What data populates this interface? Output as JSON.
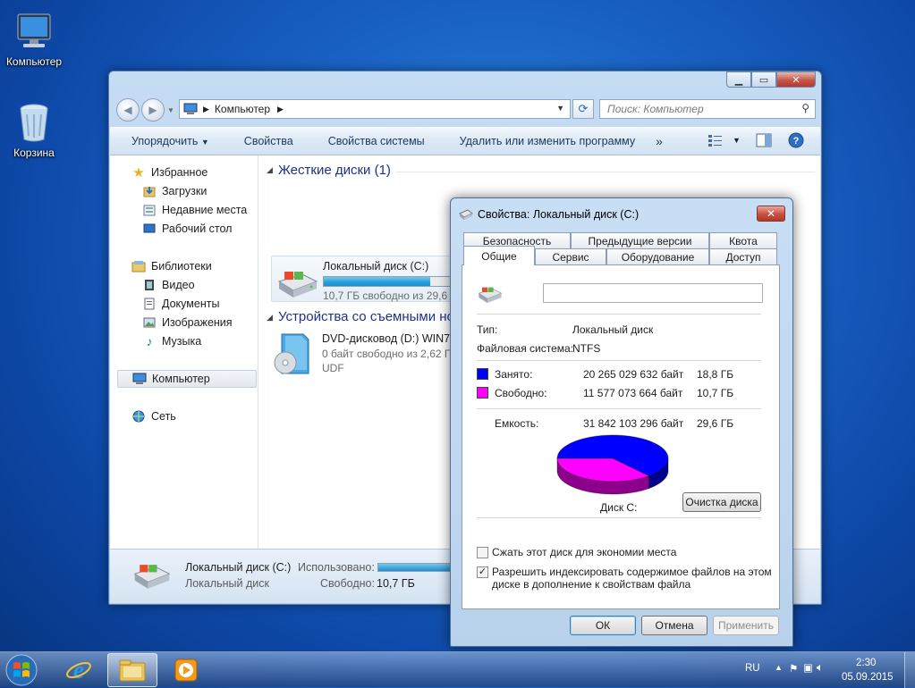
{
  "desktop": {
    "icons": [
      {
        "label": "Компьютер"
      },
      {
        "label": "Корзина"
      }
    ]
  },
  "explorer": {
    "address": "Компьютер",
    "search_placeholder": "Поиск: Компьютер",
    "commands": [
      "Упорядочить",
      "Свойства",
      "Свойства системы",
      "Удалить или изменить программу"
    ],
    "more_symbol": "»",
    "nav": {
      "favorites": "Избранное",
      "downloads": "Загрузки",
      "recent": "Недавние места",
      "desktop": "Рабочий стол",
      "libraries": "Библиотеки",
      "video": "Видео",
      "documents": "Документы",
      "images": "Изображения",
      "music": "Музыка",
      "computer": "Компьютер",
      "network": "Сеть"
    },
    "groups": {
      "hard_drives": "Жесткие диски (1)",
      "removable": "Устройства со съемными но"
    },
    "drive_c": {
      "name": "Локальный диск (C:)",
      "free_text": "10,7 ГБ свободно из 29,6 Г",
      "used_fraction": 0.64
    },
    "dvd": {
      "name": "DVD-дисковод (D:) WIN7U",
      "free_text": "0 байт свободно из 2,62 ГБ",
      "fs": "UDF"
    },
    "details": {
      "name": "Локальный диск (C:)",
      "type": "Локальный диск",
      "used_label": "Использовано:",
      "free_label": "Свободно:",
      "free_value": "10,7 ГБ"
    }
  },
  "dialog": {
    "title": "Свойства: Локальный диск (C:)",
    "close_symbol": "✕",
    "tabs_back": [
      "Безопасность",
      "Предыдущие версии",
      "Квота"
    ],
    "tabs_front": [
      "Общие",
      "Сервис",
      "Оборудование",
      "Доступ"
    ],
    "name_value": "",
    "type_label": "Тип:",
    "type_value": "Локальный диск",
    "fs_label": "Файловая система:",
    "fs_value": "NTFS",
    "used_label": "Занято:",
    "used_bytes": "20 265 029 632 байт",
    "used_gb": "18,8 ГБ",
    "free_label": "Свободно:",
    "free_bytes": "11 577 073 664 байт",
    "free_gb": "10,7 ГБ",
    "capacity_label": "Емкость:",
    "capacity_bytes": "31 842 103 296 байт",
    "capacity_gb": "29,6 ГБ",
    "disk_label": "Диск C:",
    "cleanup_button": "Очистка диска",
    "compress_label": "Сжать этот диск для экономии места",
    "compress_checked": false,
    "index_label": "Разрешить индексировать содержимое файлов на этом",
    "index_label2": "диске в дополнение к свойствам файла",
    "index_checked": true,
    "ok_button": "ОК",
    "cancel_button": "Отмена",
    "apply_button": "Применить",
    "used_color": "#0000ff",
    "free_color": "#ff00ff"
  },
  "taskbar": {
    "lang": "RU",
    "time": "2:30",
    "date": "05.09.2015"
  }
}
